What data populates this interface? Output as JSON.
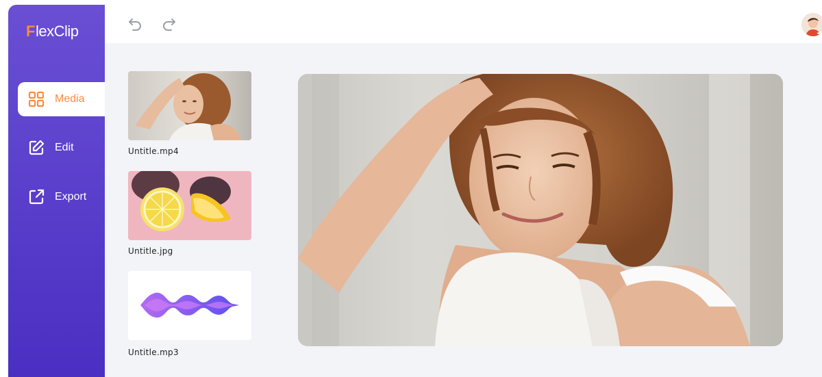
{
  "app": {
    "logo_first": "F",
    "logo_rest": "lexClip",
    "brand_color": "#5a3fcc",
    "accent_color": "#ff8a3d"
  },
  "sidebar": {
    "items": [
      {
        "label": "Media",
        "icon": "grid-icon",
        "active": true
      },
      {
        "label": "Edit",
        "icon": "edit-icon",
        "active": false
      },
      {
        "label": "Export",
        "icon": "export-icon",
        "active": false
      }
    ]
  },
  "toolbar": {
    "undo_icon": "undo-icon",
    "redo_icon": "redo-icon",
    "avatar_icon": "user-avatar"
  },
  "library": {
    "items": [
      {
        "name": "Untitle.mp4",
        "type": "video"
      },
      {
        "name": "Untitle.jpg",
        "type": "image"
      },
      {
        "name": "Untitle.mp3",
        "type": "audio"
      }
    ]
  }
}
